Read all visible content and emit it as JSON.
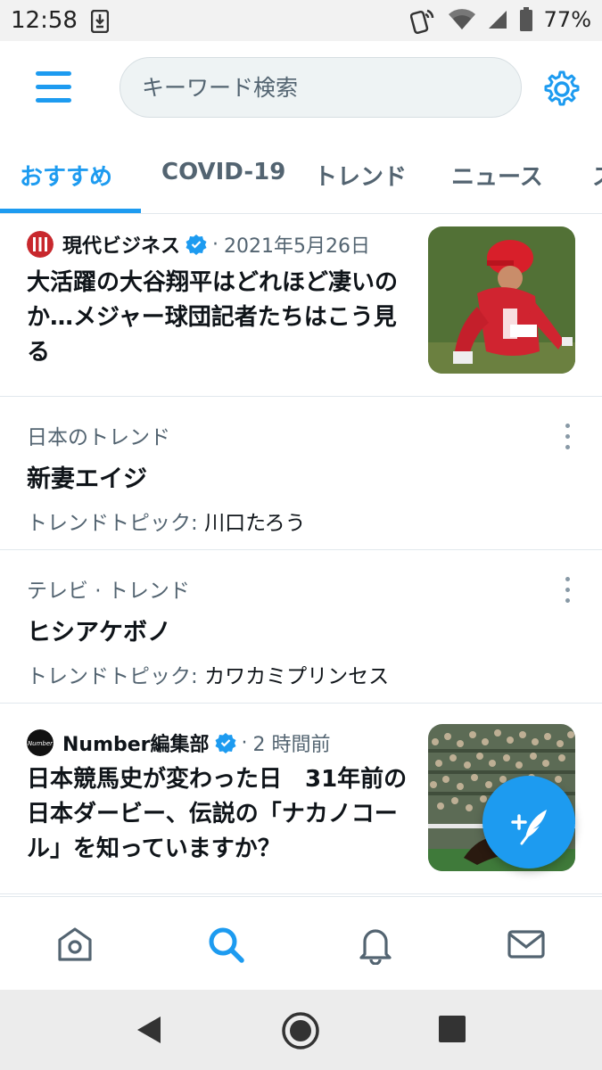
{
  "status_bar": {
    "time": "12:58",
    "battery": "77%",
    "icons": [
      "download-notification-icon",
      "nfc-icon",
      "wifi-icon",
      "cell-signal-icon",
      "battery-icon"
    ]
  },
  "header": {
    "search_placeholder": "キーワード検索",
    "menu_icon": "hamburger-menu-icon",
    "settings_icon": "gear-icon"
  },
  "tabs": [
    {
      "label": "おすすめ",
      "active": true
    },
    {
      "label": "COVID-19"
    },
    {
      "label": "トレンド"
    },
    {
      "label": "ニュース"
    },
    {
      "label": "ス"
    }
  ],
  "feed": {
    "news1": {
      "source": "現代ビジネス",
      "time": "2021年5月26日",
      "headline": "大活躍の大谷翔平はどれほど凄いのか…メジャー球団記者たちはこう見る"
    },
    "trend1": {
      "meta": "日本のトレンド",
      "title": "新妻エイジ",
      "topic_prefix": "トレンドトピック:",
      "topic": "川口たろう"
    },
    "trend2": {
      "meta": "テレビ · トレンド",
      "title": "ヒシアケボノ",
      "topic_prefix": "トレンドトピック:",
      "topic": "カワカミプリンセス"
    },
    "news2": {
      "source": "Number編集部",
      "time": "2 時間前",
      "headline": "日本競馬史が変わった日　31年前の日本ダービー、伝説の「ナカノコール」を知っていますか？",
      "logo_text": "Number"
    }
  },
  "fab": {
    "icon": "compose-tweet-icon"
  },
  "bottom_nav": [
    "home-icon",
    "search-icon",
    "notifications-icon",
    "messages-icon"
  ],
  "system_nav": [
    "back-icon",
    "home-circle-icon",
    "recents-icon"
  ],
  "colors": {
    "accent": "#1d9bf0",
    "text": "#0f1419",
    "secondary": "#536471"
  }
}
